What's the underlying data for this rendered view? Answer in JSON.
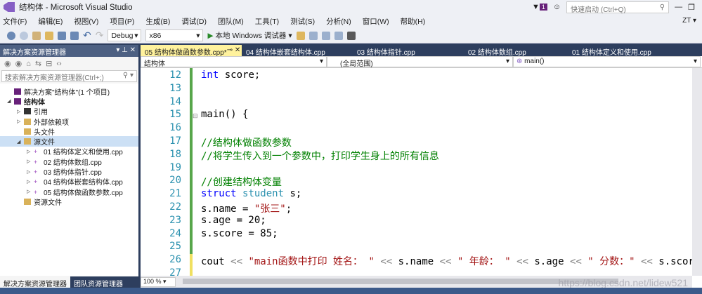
{
  "window": {
    "title": "结构体 - Microsoft Visual Studio",
    "notifications": "1",
    "quick_launch_placeholder": "快速启动 (Ctrl+Q)",
    "user": "ZT ▾"
  },
  "menu": [
    "文件(F)",
    "编辑(E)",
    "视图(V)",
    "项目(P)",
    "生成(B)",
    "调试(D)",
    "团队(M)",
    "工具(T)",
    "测试(S)",
    "分析(N)",
    "窗口(W)",
    "帮助(H)"
  ],
  "toolbar": {
    "config": "Debug",
    "platform": "x86",
    "run_label": "本地 Windows 调试器"
  },
  "solution_explorer": {
    "title": "解决方案资源管理器",
    "search_placeholder": "搜索解决方案资源管理器(Ctrl+;)",
    "items": [
      {
        "label": "解决方案\"结构体\"(1 个项目)",
        "level": 0,
        "arrow": "",
        "icon": "solution"
      },
      {
        "label": "结构体",
        "level": 0,
        "arrow": "◢",
        "icon": "project"
      },
      {
        "label": "引用",
        "level": 1,
        "arrow": "▷",
        "icon": "references"
      },
      {
        "label": "外部依赖项",
        "level": 1,
        "arrow": "▷",
        "icon": "folder"
      },
      {
        "label": "头文件",
        "level": 1,
        "arrow": "",
        "icon": "folder"
      },
      {
        "label": "源文件",
        "level": 1,
        "arrow": "◢",
        "icon": "folder",
        "selected": true
      },
      {
        "label": "01 结构体定义和使用.cpp",
        "level": 2,
        "arrow": "▷",
        "icon": "cpp"
      },
      {
        "label": "02 结构体数组.cpp",
        "level": 2,
        "arrow": "▷",
        "icon": "cpp"
      },
      {
        "label": "03 结构体指针.cpp",
        "level": 2,
        "arrow": "▷",
        "icon": "cpp"
      },
      {
        "label": "04 结构体嵌套结构体.cpp",
        "level": 2,
        "arrow": "▷",
        "icon": "cpp"
      },
      {
        "label": "05 结构体做函数参数.cpp",
        "level": 2,
        "arrow": "▷",
        "icon": "cpp"
      },
      {
        "label": "资源文件",
        "level": 1,
        "arrow": "",
        "icon": "folder"
      }
    ],
    "bottom_tabs": [
      "解决方案资源管理器",
      "团队资源管理器"
    ]
  },
  "editor": {
    "tabs": [
      "05 结构体做函数参数.cpp*",
      "04 结构体嵌套结构体.cpp",
      "03 结构体指针.cpp",
      "02 结构体数组.cpp",
      "01 结构体定义和使用.cpp"
    ],
    "nav": {
      "project": "结构体",
      "scope": "(全局范围)",
      "member": "main()"
    },
    "zoom": "100 %",
    "watermark": "https://blog.csdn.net/lidew521",
    "lines": [
      {
        "n": "12",
        "tokens": [
          [
            "kw",
            "int"
          ],
          [
            "pl",
            " score;"
          ]
        ]
      },
      {
        "n": "13",
        "tokens": []
      },
      {
        "n": "14",
        "tokens": []
      },
      {
        "n": "15",
        "tokens": [
          [
            "pl",
            "main() {"
          ]
        ]
      },
      {
        "n": "16",
        "tokens": []
      },
      {
        "n": "17",
        "tokens": [
          [
            "cm",
            "//结构体做函数参数"
          ]
        ]
      },
      {
        "n": "18",
        "tokens": [
          [
            "cm",
            "//将学生传入到一个参数中，打印学生身上的所有信息"
          ]
        ]
      },
      {
        "n": "19",
        "tokens": []
      },
      {
        "n": "20",
        "tokens": [
          [
            "cm",
            "//创建结构体变量"
          ]
        ]
      },
      {
        "n": "21",
        "tokens": [
          [
            "kw",
            "struct"
          ],
          [
            "pl",
            " "
          ],
          [
            "ty",
            "student"
          ],
          [
            "pl",
            " s;"
          ]
        ]
      },
      {
        "n": "22",
        "tokens": [
          [
            "pl",
            "s.name = "
          ],
          [
            "st",
            "\"张三\""
          ],
          [
            "pl",
            ";"
          ]
        ]
      },
      {
        "n": "23",
        "tokens": [
          [
            "pl",
            "s.age = 20;"
          ]
        ]
      },
      {
        "n": "24",
        "tokens": [
          [
            "pl",
            "s.score = 85;"
          ]
        ]
      },
      {
        "n": "25",
        "tokens": []
      },
      {
        "n": "26",
        "tokens": [
          [
            "pl",
            "cout "
          ],
          [
            "op",
            "<<"
          ],
          [
            "pl",
            " "
          ],
          [
            "st",
            "\"main函数中打印 姓名： \""
          ],
          [
            "pl",
            " "
          ],
          [
            "op",
            "<<"
          ],
          [
            "pl",
            " s.name "
          ],
          [
            "op",
            "<<"
          ],
          [
            "pl",
            " "
          ],
          [
            "st",
            "\" 年龄： \""
          ],
          [
            "pl",
            " "
          ],
          [
            "op",
            "<<"
          ],
          [
            "pl",
            " s.age "
          ],
          [
            "op",
            "<<"
          ],
          [
            "pl",
            " "
          ],
          [
            "st",
            "\" 分数：\""
          ],
          [
            "pl",
            " "
          ],
          [
            "op",
            "<<"
          ],
          [
            "pl",
            " s.score"
          ]
        ]
      },
      {
        "n": "27",
        "tokens": []
      }
    ]
  }
}
